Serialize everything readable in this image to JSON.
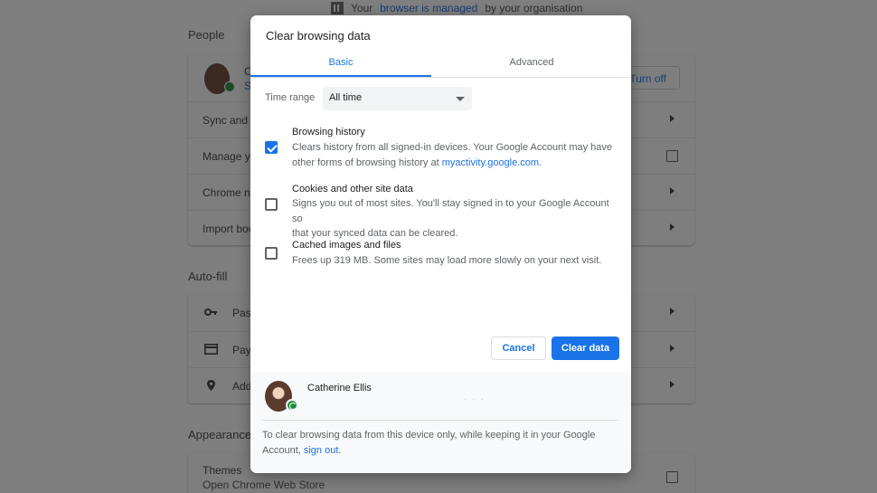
{
  "background": {
    "managed": {
      "prefix": "Your",
      "link": "browser is managed",
      "suffix": "by your organisation"
    },
    "people_title": "People",
    "profile_initial": "C",
    "profile_sub": "S",
    "turn_off": "Turn off",
    "people_rows": [
      "Sync and G",
      "Manage yo",
      "Chrome na",
      "Import boo"
    ],
    "autofill_title": "Auto-fill",
    "autofill_rows": [
      "Pass",
      "Payr",
      "Add"
    ],
    "appearance_title": "Appearance",
    "themes_label": "Themes",
    "themes_sub": "Open Chrome Web Store"
  },
  "dialog": {
    "title": "Clear browsing data",
    "tabs": [
      {
        "label": "Basic",
        "selected": true
      },
      {
        "label": "Advanced",
        "selected": false
      }
    ],
    "time_range": {
      "label": "Time range",
      "value": "All time"
    },
    "options": [
      {
        "title": "Browsing history",
        "checked": true,
        "desc_line1": "Clears history from all signed-in devices. Your Google Account may have",
        "desc_line2_prefix": "other forms of browsing history at ",
        "desc_link": "myactivity.google.com",
        "desc_line2_suffix": "."
      },
      {
        "title": "Cookies and other site data",
        "checked": false,
        "desc_line1": "Signs you out of most sites. You'll stay signed in to your Google Account so",
        "desc_line2": "that your synced data can be cleared."
      },
      {
        "title": "Cached images and files",
        "checked": false,
        "desc_line1": "Frees up 319 MB. Some sites may load more slowly on your next visit."
      }
    ],
    "cancel_label": "Cancel",
    "clear_label": "Clear data",
    "footer": {
      "name": "Catherine Ellis",
      "email_masked": "· · ·",
      "text_line1": "To clear browsing data from this device only, while keeping it in your Google",
      "text_line2_prefix": "Account, ",
      "signout_link": "sign out",
      "text_line2_suffix": "."
    }
  },
  "colors": {
    "accent": "#1a73e8",
    "overlay": "#7f7f7f",
    "status_green": "#1e8e3e"
  }
}
